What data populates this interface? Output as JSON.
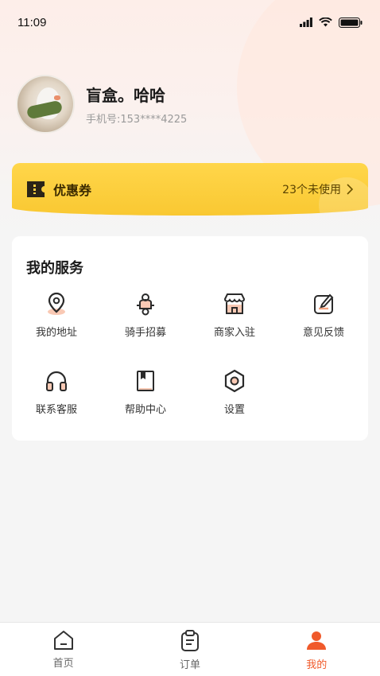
{
  "status_bar": {
    "time": "11:09"
  },
  "profile": {
    "username": "盲盒。哈哈",
    "phone": "手机号:153****4225"
  },
  "coupon": {
    "title": "优惠券",
    "count_text": "23个未使用"
  },
  "services": {
    "title": "我的服务",
    "items": [
      {
        "label": "我的地址",
        "icon": "location-icon"
      },
      {
        "label": "骑手招募",
        "icon": "rider-icon"
      },
      {
        "label": "商家入驻",
        "icon": "store-icon"
      },
      {
        "label": "意见反馈",
        "icon": "feedback-icon"
      },
      {
        "label": "联系客服",
        "icon": "headset-icon"
      },
      {
        "label": "帮助中心",
        "icon": "help-book-icon"
      },
      {
        "label": "设置",
        "icon": "settings-icon"
      }
    ]
  },
  "tabbar": {
    "items": [
      {
        "label": "首页",
        "icon": "home-icon",
        "active": false
      },
      {
        "label": "订单",
        "icon": "order-icon",
        "active": false
      },
      {
        "label": "我的",
        "icon": "user-icon",
        "active": true
      }
    ]
  },
  "colors": {
    "accent": "#f05a2b",
    "coupon_yellow": "#fdd043",
    "icon_orange": "#f3a27f"
  }
}
